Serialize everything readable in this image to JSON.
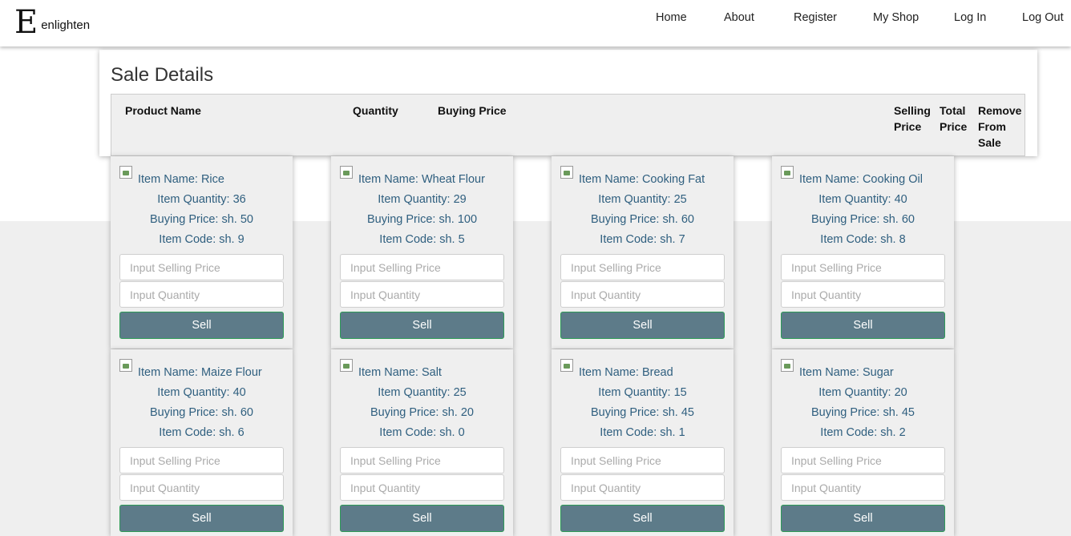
{
  "brand": {
    "mark": "E",
    "name": "enlighten"
  },
  "nav": {
    "home": "Home",
    "about": "About",
    "register": "Register",
    "my_shop": "My Shop",
    "log_in": "Log In",
    "log_out": "Log Out"
  },
  "sale_details": {
    "title": "Sale Details",
    "columns": {
      "product_name": "Product Name",
      "quantity": "Quantity",
      "buying_price": "Buying Price",
      "selling_price": "Selling Price",
      "total_price": "Total Price",
      "remove": "Remove From Sale"
    }
  },
  "card_placeholders": {
    "selling_price": "Input Selling Price",
    "quantity": "Input Quantity"
  },
  "sell_label": "Sell",
  "items": [
    {
      "name": "Item Name: Rice",
      "quantity": "Item Quantity: 36",
      "buying_price": "Buying Price: sh. 50",
      "code": "Item Code: sh. 9"
    },
    {
      "name": "Item Name: Wheat Flour",
      "quantity": "Item Quantity: 29",
      "buying_price": "Buying Price: sh. 100",
      "code": "Item Code: sh. 5"
    },
    {
      "name": "Item Name: Cooking Fat",
      "quantity": "Item Quantity: 25",
      "buying_price": "Buying Price: sh. 60",
      "code": "Item Code: sh. 7"
    },
    {
      "name": "Item Name: Cooking Oil",
      "quantity": "Item Quantity: 40",
      "buying_price": "Buying Price: sh. 60",
      "code": "Item Code: sh. 8"
    },
    {
      "name": "Item Name: Maize Flour",
      "quantity": "Item Quantity: 40",
      "buying_price": "Buying Price: sh. 60",
      "code": "Item Code: sh. 6"
    },
    {
      "name": "Item Name: Salt",
      "quantity": "Item Quantity: 25",
      "buying_price": "Buying Price: sh. 20",
      "code": "Item Code: sh. 0"
    },
    {
      "name": "Item Name: Bread",
      "quantity": "Item Quantity: 15",
      "buying_price": "Buying Price: sh. 45",
      "code": "Item Code: sh. 1"
    },
    {
      "name": "Item Name: Sugar",
      "quantity": "Item Quantity: 20",
      "buying_price": "Buying Price: sh. 45",
      "code": "Item Code: sh. 2"
    }
  ],
  "colors": {
    "sell_button": "#5d7b89",
    "sell_button_border": "#2e9b57",
    "item_text": "#2f5f7f",
    "panel_background": "#efefef"
  }
}
